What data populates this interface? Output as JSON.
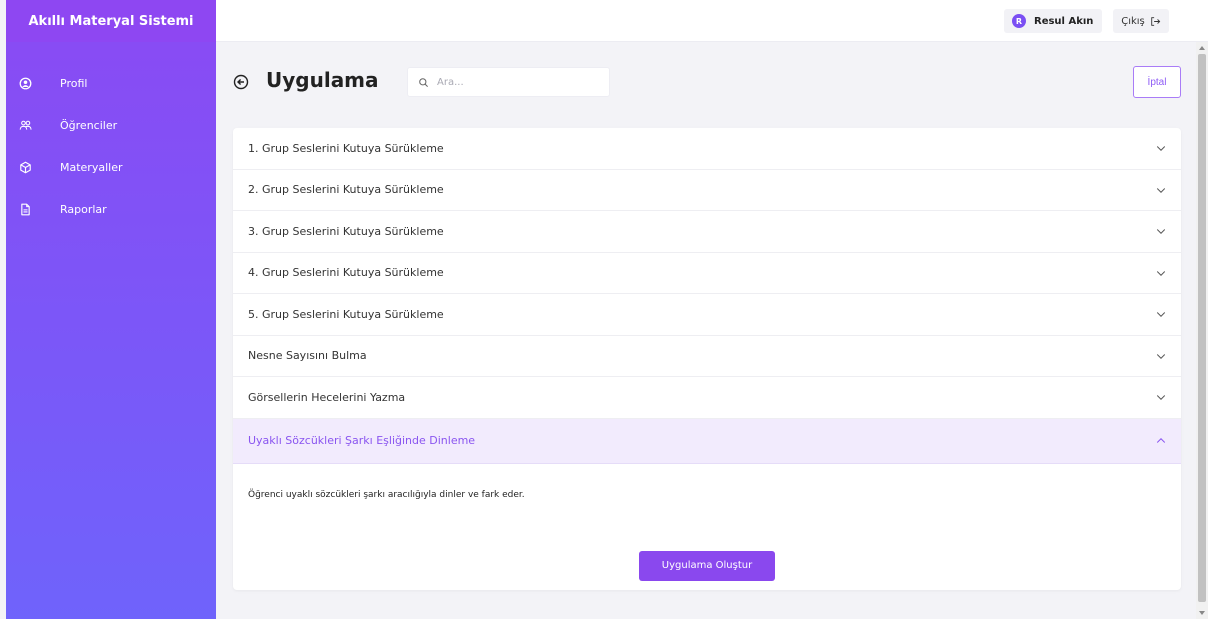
{
  "sidebar": {
    "brand": "Akıllı Materyal Sistemi",
    "items": [
      {
        "label": "Profil",
        "icon": "user-circle-icon"
      },
      {
        "label": "Öğrenciler",
        "icon": "users-icon"
      },
      {
        "label": "Materyaller",
        "icon": "cube-icon"
      },
      {
        "label": "Raporlar",
        "icon": "document-icon"
      }
    ]
  },
  "topbar": {
    "user_initial": "R",
    "user_name": "Resul Akın",
    "logout_label": "Çıkış"
  },
  "page": {
    "title": "Uygulama",
    "search_placeholder": "Ara...",
    "cancel_label": "İptal"
  },
  "accordion": {
    "items": [
      {
        "label": "1. Grup Seslerini Kutuya Sürükleme"
      },
      {
        "label": "2. Grup Seslerini Kutuya Sürükleme"
      },
      {
        "label": "3. Grup Seslerini Kutuya Sürükleme"
      },
      {
        "label": "4. Grup Seslerini Kutuya Sürükleme"
      },
      {
        "label": "5. Grup Seslerini Kutuya Sürükleme"
      },
      {
        "label": "Nesne Sayısını Bulma"
      },
      {
        "label": "Görsellerin Hecelerini Yazma"
      }
    ],
    "active": {
      "label": "Uyaklı Sözcükleri Şarkı Eşliğinde Dinleme",
      "description": "Öğrenci uyaklı sözcükleri şarkı aracılığıyla dinler ve fark eder.",
      "create_label": "Uygulama Oluştur"
    }
  },
  "colors": {
    "accent": "#8a48ee",
    "sidebar_top": "#8a4af3",
    "sidebar_bottom": "#6f63fb"
  }
}
